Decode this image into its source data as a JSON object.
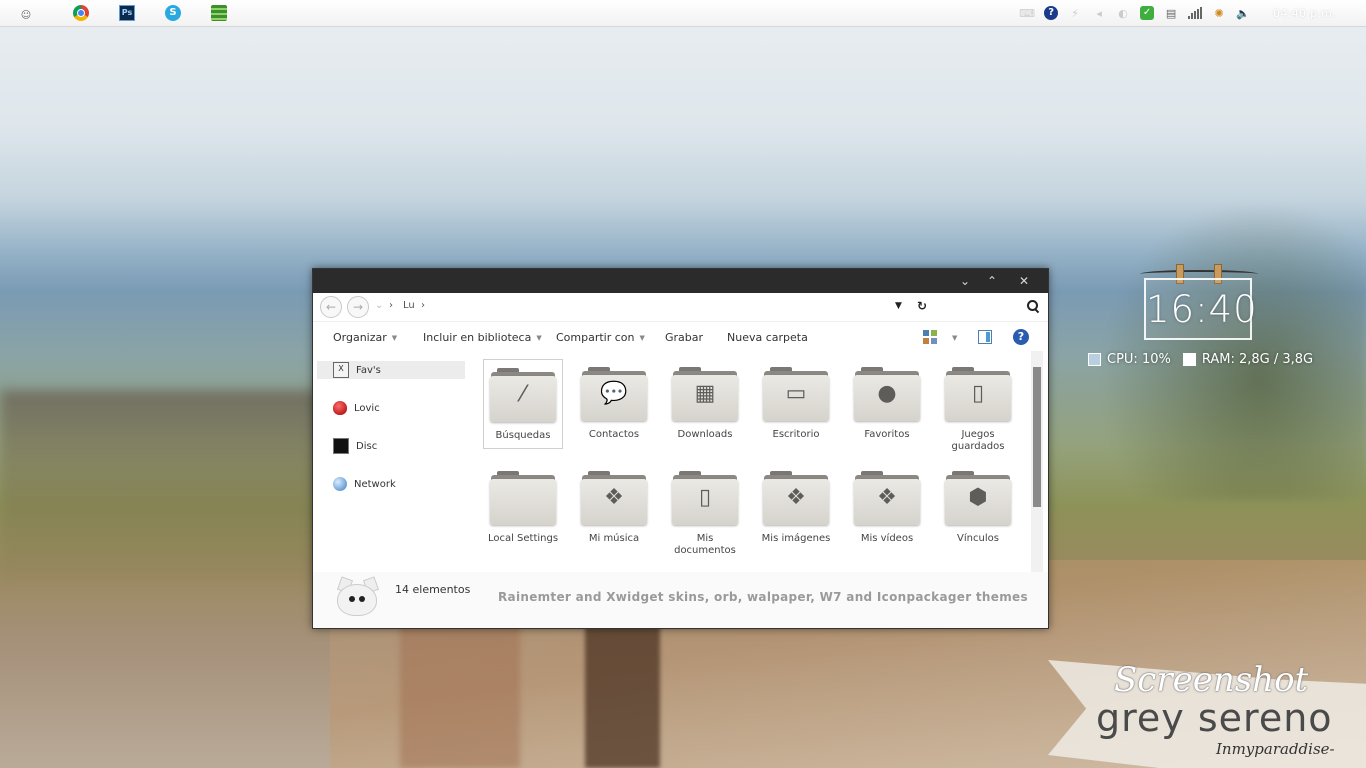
{
  "taskbar": {
    "apps": [
      {
        "name": "chrome"
      },
      {
        "name": "photoshop",
        "label": "Ps"
      },
      {
        "name": "skype",
        "label": "S"
      },
      {
        "name": "stack"
      }
    ],
    "clock": "04:40 p.m."
  },
  "window": {
    "breadcrumb": [
      "Lu"
    ],
    "toolbar": {
      "organize": "Organizar",
      "include": "Incluir en biblioteca",
      "share": "Compartir con",
      "burn": "Grabar",
      "new_folder": "Nueva carpeta"
    },
    "sidebar": [
      {
        "label": "Fav's",
        "icon": "fav-icon",
        "badge": "X"
      },
      {
        "label": "Lovic",
        "icon": "lovic-icon"
      },
      {
        "label": "Disc",
        "icon": "disc-icon"
      },
      {
        "label": "Network",
        "icon": "network-icon"
      }
    ],
    "folders": [
      {
        "label": "Búsquedas",
        "icon": "magic-wand-icon",
        "glyph": "⁄"
      },
      {
        "label": "Contactos",
        "icon": "speech-bubbles-icon",
        "glyph": "💬"
      },
      {
        "label": "Downloads",
        "icon": "pixel-arrow-icon",
        "glyph": "▦"
      },
      {
        "label": "Escritorio",
        "icon": "window-icon",
        "glyph": "▭"
      },
      {
        "label": "Favoritos",
        "icon": "apple-icon",
        "glyph": "●"
      },
      {
        "label": "Juegos guardados",
        "icon": "phone-icon",
        "glyph": "▯"
      },
      {
        "label": "Local Settings",
        "icon": "plain-folder-icon",
        "glyph": ""
      },
      {
        "label": "Mi música",
        "icon": "dropbox-icon",
        "glyph": "❖"
      },
      {
        "label": "Mis documentos",
        "icon": "document-icon",
        "glyph": "▯"
      },
      {
        "label": "Mis imágenes",
        "icon": "dropbox-icon",
        "glyph": "❖"
      },
      {
        "label": "Mis vídeos",
        "icon": "dropbox-icon",
        "glyph": "❖"
      },
      {
        "label": "Vínculos",
        "icon": "cube-icon",
        "glyph": "⬢"
      }
    ],
    "status": {
      "count": "14 elementos",
      "tagline": "Rainemter and Xwidget skins, orb, walpaper, W7 and Iconpackager themes"
    }
  },
  "widgets": {
    "clock": "16:40",
    "cpu": "CPU: 10%",
    "ram": "RAM: 2,8G / 3,8G"
  },
  "banner": {
    "title": "Screenshot",
    "subtitle": "grey sereno",
    "author": "Inmyparaddise-"
  }
}
